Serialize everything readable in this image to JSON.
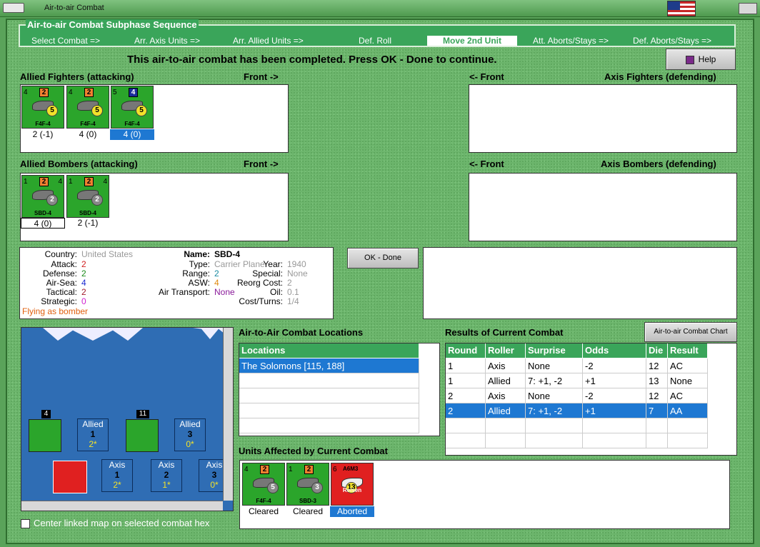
{
  "window": {
    "title": "Air-to-air Combat"
  },
  "phase": {
    "title": "Air-to-air Combat Subphase Sequence",
    "steps": [
      "Select Combat =>",
      "Arr. Axis Units =>",
      "Arr. Allied Units =>",
      "Def. Roll",
      "Move 2nd Unit",
      "Att. Aborts/Stays =>",
      "Def. Aborts/Stays =>"
    ],
    "active_index": 4
  },
  "message": "This air-to-air combat has been completed.  Press OK - Done to continue.",
  "help_label": "Help",
  "sections": {
    "allied_fighters": "Allied Fighters (attacking)",
    "axis_fighters": "Axis Fighters (defending)",
    "allied_bombers": "Allied Bombers (attacking)",
    "axis_bombers": "Axis Bombers (defending)",
    "front_right": "Front ->",
    "front_left": "<- Front"
  },
  "allied_fighters": [
    {
      "name": "F4F-4",
      "str": "2",
      "att": "4",
      "circ": "5",
      "label": "2 (-1)"
    },
    {
      "name": "F4F-4",
      "str": "2",
      "att": "4",
      "circ": "5",
      "label": "4 (0)"
    },
    {
      "name": "F4F-4",
      "str": "4",
      "att": "5",
      "circ": "5",
      "label": "4 (0)"
    }
  ],
  "allied_bombers": [
    {
      "name": "SBD-4",
      "str": "2",
      "att": "1",
      "mv": "4",
      "circ": "2",
      "label": "4 (0)"
    },
    {
      "name": "SBD-4",
      "str": "2",
      "att": "1",
      "mv": "4",
      "circ": "2",
      "label": "2 (-1)"
    }
  ],
  "ok_done_label": "OK - Done",
  "unit_info": {
    "country_label": "Country:",
    "country": "United States",
    "attack_label": "Attack:",
    "attack": "2",
    "defense_label": "Defense:",
    "defense": "2",
    "airsea_label": "Air-Sea:",
    "airsea": "4",
    "tactical_label": "Tactical:",
    "tactical": "2",
    "strategic_label": "Strategic:",
    "strategic": "0",
    "flying_note": "Flying as bomber",
    "name_label": "Name:",
    "name": "SBD-4",
    "type_label": "Type:",
    "type": "Carrier Plane",
    "range_label": "Range:",
    "range": "2",
    "asw_label": "ASW:",
    "asw": "4",
    "airtransport_label": "Air Transport:",
    "airtransport": "None",
    "year_label": "Year:",
    "year": "1940",
    "special_label": "Special:",
    "special": "None",
    "reorg_label": "Reorg Cost:",
    "reorg": "2",
    "oil_label": "Oil:",
    "oil": "0.1",
    "costturns_label": "Cost/Turns:",
    "costturns": "1/4"
  },
  "map": {
    "top_counter_1": "4",
    "top_counter_2": "11",
    "boxes": [
      {
        "side": "Allied",
        "num": "1",
        "val": "2*"
      },
      {
        "side": "Allied",
        "num": "3",
        "val": "0*"
      },
      {
        "side": "Axis",
        "num": "1",
        "val": "2*"
      },
      {
        "side": "Axis",
        "num": "2",
        "val": "1*"
      },
      {
        "side": "Axis",
        "num": "3",
        "val": "0*"
      }
    ]
  },
  "locations": {
    "title": "Air-to-Air Combat Locations",
    "header": "Locations",
    "items": [
      "The Solomons [115, 188]"
    ]
  },
  "results": {
    "title": "Results of Current Combat",
    "chart_button": "Air-to-air Combat Chart",
    "headers": [
      "Round",
      "Roller",
      "Surprise",
      "Odds",
      "Die",
      "Result"
    ],
    "rows": [
      [
        "1",
        "Axis",
        "None",
        "-2",
        "12",
        "AC"
      ],
      [
        "1",
        "Allied",
        "7: +1, -2",
        "+1",
        "13",
        "None"
      ],
      [
        "2",
        "Axis",
        "None",
        "-2",
        "12",
        "AC"
      ],
      [
        "2",
        "Allied",
        "7: +1, -2",
        "+1",
        "7",
        "AA"
      ]
    ],
    "selected_row": 3
  },
  "affected": {
    "title": "Units Affected by Current Combat",
    "units": [
      {
        "name": "F4F-4",
        "str": "2",
        "att": "4",
        "circ": "5",
        "label": "Cleared"
      },
      {
        "name": "SBD-3",
        "str": "2",
        "att": "1",
        "circ": "3",
        "label": "Cleared"
      },
      {
        "name": "Reisen",
        "str": "A6M3",
        "att": "6",
        "circ": "13",
        "label": "Aborted"
      }
    ]
  },
  "center_map_label": "Center linked map on selected combat hex"
}
